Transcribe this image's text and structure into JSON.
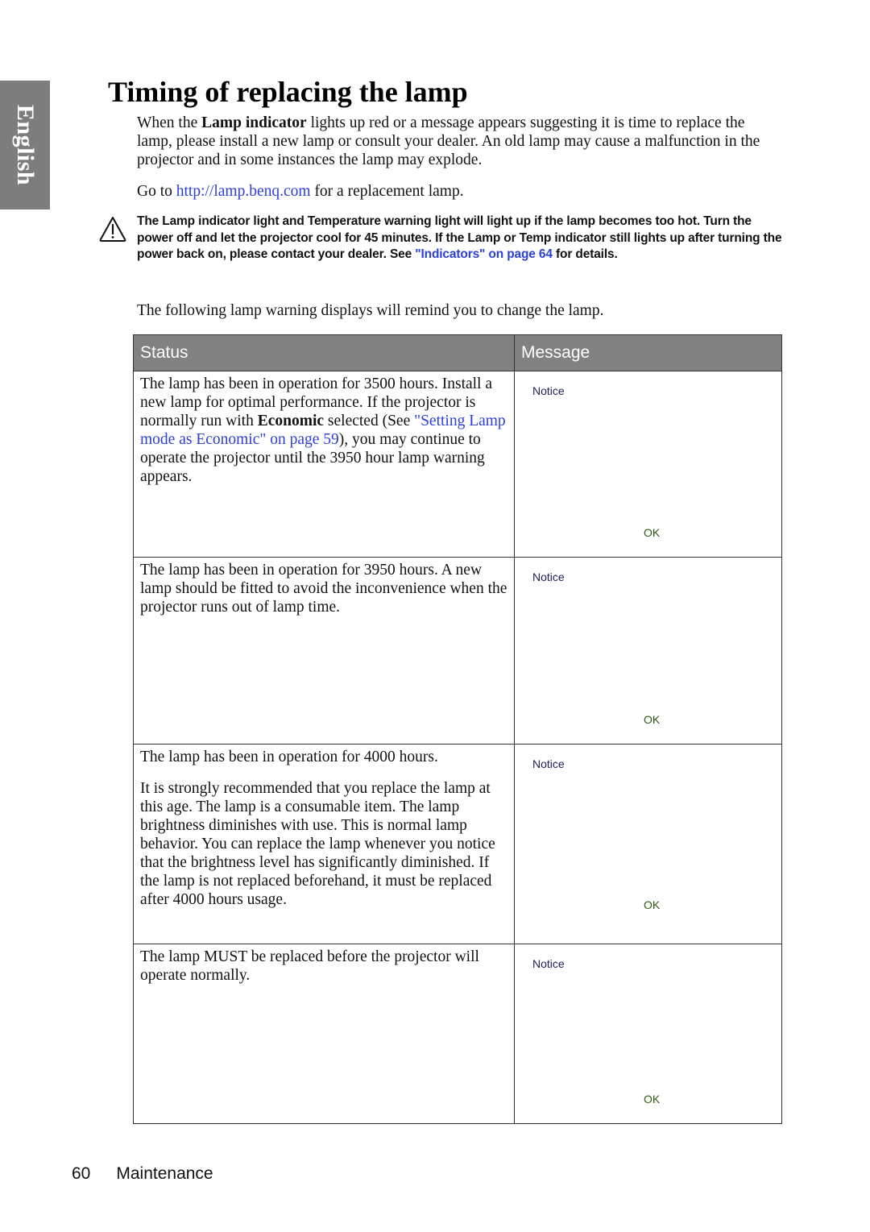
{
  "side_tab": {
    "language": "English"
  },
  "page_title": "Timing of replacing the lamp",
  "intro": {
    "before_bold": "When the ",
    "bold": "Lamp indicator",
    "after_bold": " lights up red or a message appears suggesting it is time to replace the lamp, please install a new lamp or consult your dealer. An old lamp may cause a malfunction in the projector and in some instances the lamp may explode."
  },
  "goto": {
    "before_link": "Go to ",
    "link": "http://lamp.benq.com",
    "after_link": " for a replacement lamp."
  },
  "warning": {
    "icon": "warning-triangle-icon",
    "text": "The Lamp indicator light and Temperature warning light will light up if the lamp becomes too hot. Turn the power off and let the projector cool for 45 minutes. If the Lamp or Temp indicator still lights up after turning the power back on, please contact your dealer. See ",
    "link": "\"Indicators\" on page 64",
    "after_link": " for details."
  },
  "following_text": "The following lamp warning displays will remind you to change the lamp.",
  "table": {
    "headers": {
      "status": "Status",
      "message": "Message"
    },
    "rows": [
      {
        "status": {
          "part1": "The lamp has been in operation for 3500 hours. Install a new lamp for optimal performance. If the projector is normally run with ",
          "bold": "Economic",
          "part2": " selected (See ",
          "link": "\"Setting Lamp mode as Economic\" on page 59",
          "part3": "), you may continue to operate the projector until the 3950 hour lamp warning appears."
        },
        "message": {
          "title": "Notice",
          "button": "OK"
        }
      },
      {
        "status": {
          "text": "The lamp has been in operation for 3950 hours. A new lamp should be fitted to avoid the inconvenience when the projector runs out of lamp time."
        },
        "message": {
          "title": "Notice",
          "button": "OK"
        }
      },
      {
        "status": {
          "text": "The lamp has been in operation for 4000 hours.",
          "text2": "It is strongly recommended that you replace the lamp at this age. The lamp is a consumable item. The lamp brightness diminishes with use. This is normal lamp behavior. You can replace the lamp whenever you notice that the brightness level has significantly diminished. If the lamp is not replaced beforehand, it must be replaced after 4000 hours usage."
        },
        "message": {
          "title": "Notice",
          "button": "OK"
        }
      },
      {
        "status": {
          "text": "The lamp MUST be replaced before the projector will operate normally."
        },
        "message": {
          "title": "Notice",
          "button": "OK"
        }
      }
    ]
  },
  "footer": {
    "page_number": "60",
    "section": "Maintenance"
  },
  "colors": {
    "link": "#2b3fd6",
    "header_bg": "#818181",
    "side_tab_bg": "#7d7d7d",
    "notice_text": "#1b1f55",
    "ok_text": "#2f5a14"
  }
}
